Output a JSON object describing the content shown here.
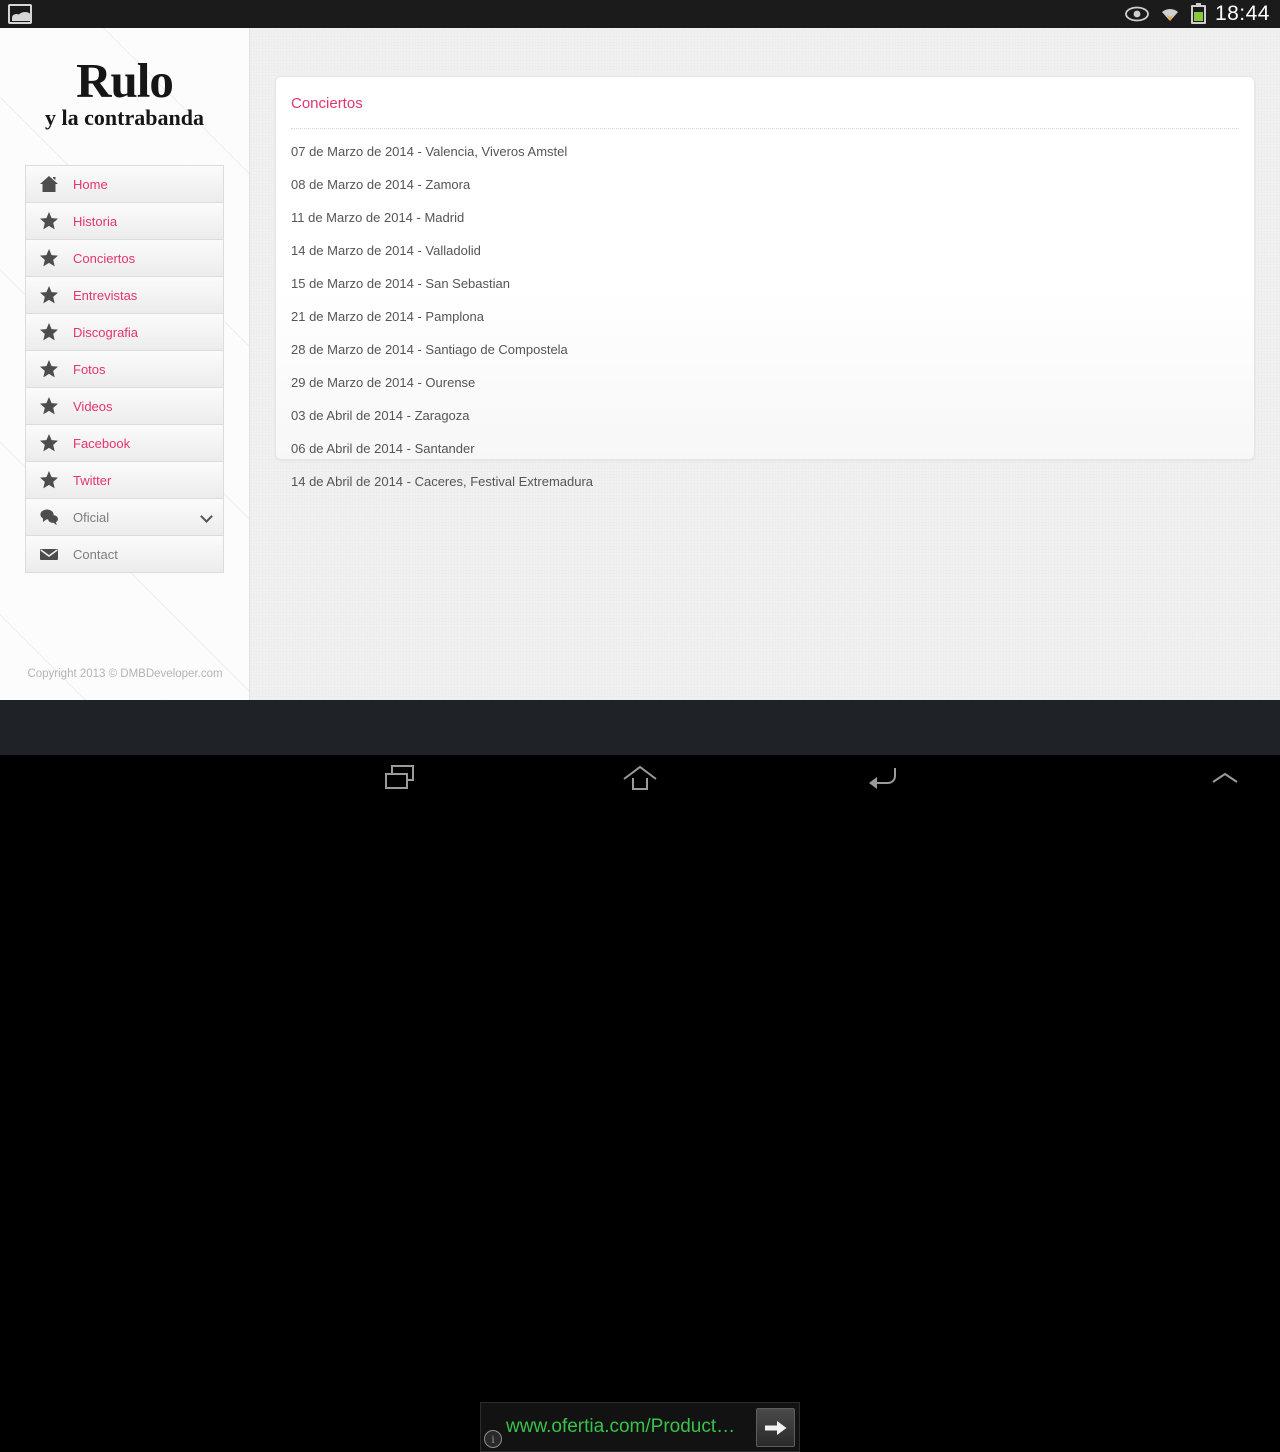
{
  "statusbar": {
    "photo_icon": "photo-icon",
    "eye_icon": "eye-icon",
    "wifi_icon": "wifi-icon",
    "battery_icon": "battery-icon",
    "time": "18:44"
  },
  "sidebar": {
    "logo": {
      "line1": "Rulo",
      "line2": "y la contrabanda"
    },
    "menu": [
      {
        "label": "Home",
        "icon": "home-icon",
        "active": false,
        "muted": false,
        "chevron": false
      },
      {
        "label": "Historia",
        "icon": "star-icon",
        "active": false,
        "muted": false,
        "chevron": false
      },
      {
        "label": "Conciertos",
        "icon": "star-icon",
        "active": true,
        "muted": false,
        "chevron": false
      },
      {
        "label": "Entrevistas",
        "icon": "star-icon",
        "active": false,
        "muted": false,
        "chevron": false
      },
      {
        "label": "Discografia",
        "icon": "star-icon",
        "active": false,
        "muted": false,
        "chevron": false
      },
      {
        "label": "Fotos",
        "icon": "star-icon",
        "active": false,
        "muted": false,
        "chevron": false
      },
      {
        "label": "Videos",
        "icon": "star-icon",
        "active": false,
        "muted": false,
        "chevron": false
      },
      {
        "label": "Facebook",
        "icon": "star-icon",
        "active": false,
        "muted": false,
        "chevron": false
      },
      {
        "label": "Twitter",
        "icon": "star-icon",
        "active": false,
        "muted": false,
        "chevron": false
      },
      {
        "label": "Oficial",
        "icon": "comment-icon",
        "active": false,
        "muted": true,
        "chevron": true
      },
      {
        "label": "Contact",
        "icon": "envelope-icon",
        "active": false,
        "muted": true,
        "chevron": false
      }
    ],
    "copyright": "Copyright 2013 © DMBDeveloper.com"
  },
  "main": {
    "card_title": "Conciertos",
    "concerts": [
      "07 de Marzo de 2014 - Valencia, Viveros Amstel",
      "08 de Marzo de 2014 - Zamora",
      "11 de Marzo de 2014 - Madrid",
      "14 de Marzo de 2014 - Valladolid",
      "15 de Marzo de 2014 - San Sebastian",
      "21 de Marzo de 2014 - Pamplona",
      "28 de Marzo de 2014 - Santiago de Compostela",
      "29 de Marzo de 2014 - Ourense",
      "03 de Abril de 2014 - Zaragoza",
      "06 de Abril de 2014 - Santander",
      "14 de Abril de 2014 - Caceres, Festival Extremadura"
    ]
  },
  "ad": {
    "url": "www.ofertia.com/Productos…",
    "info_label": "i",
    "go_icon": "arrow-right-icon"
  },
  "navbar": {
    "recent_icon": "recents-icon",
    "home_icon": "home-outline-icon",
    "back_icon": "back-arrow-icon",
    "expand_icon": "chevron-up-icon"
  },
  "colors": {
    "accent_pink": "#e2366d",
    "link_gray": "#7d7d7d",
    "text_gray": "#555555",
    "ad_green": "#3ac14a",
    "battery_green": "#8cc63e"
  }
}
